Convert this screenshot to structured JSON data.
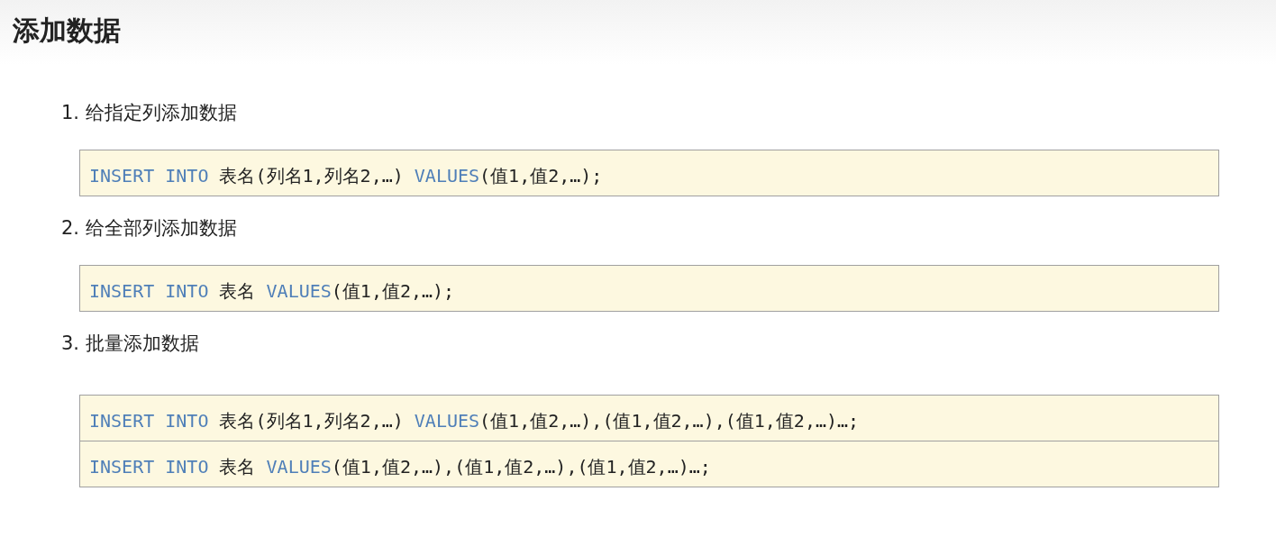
{
  "title": "添加数据",
  "sections": [
    {
      "number": "1.",
      "heading": "给指定列添加数据",
      "code_lines": [
        [
          {
            "kind": "keyword",
            "text": "INSERT INTO"
          },
          {
            "kind": "plain",
            "text": " 表名(列名1,列名2,…) "
          },
          {
            "kind": "keyword",
            "text": "VALUES"
          },
          {
            "kind": "plain",
            "text": "(值1,值2,…);"
          }
        ]
      ]
    },
    {
      "number": "2.",
      "heading": "给全部列添加数据",
      "code_lines": [
        [
          {
            "kind": "keyword",
            "text": "INSERT INTO"
          },
          {
            "kind": "plain",
            "text": " 表名 "
          },
          {
            "kind": "keyword",
            "text": "VALUES"
          },
          {
            "kind": "plain",
            "text": "(值1,值2,…);"
          }
        ]
      ]
    },
    {
      "number": "3.",
      "heading": "批量添加数据",
      "code_lines": [
        [
          {
            "kind": "keyword",
            "text": "INSERT INTO"
          },
          {
            "kind": "plain",
            "text": " 表名(列名1,列名2,…) "
          },
          {
            "kind": "keyword",
            "text": "VALUES"
          },
          {
            "kind": "plain",
            "text": "(值1,值2,…),(值1,值2,…),(值1,值2,…)…;"
          }
        ],
        [
          {
            "kind": "keyword",
            "text": "INSERT INTO"
          },
          {
            "kind": "plain",
            "text": " 表名 "
          },
          {
            "kind": "keyword",
            "text": "VALUES"
          },
          {
            "kind": "plain",
            "text": "(值1,值2,…),(值1,值2,…),(值1,值2,…)…;"
          }
        ]
      ]
    }
  ]
}
